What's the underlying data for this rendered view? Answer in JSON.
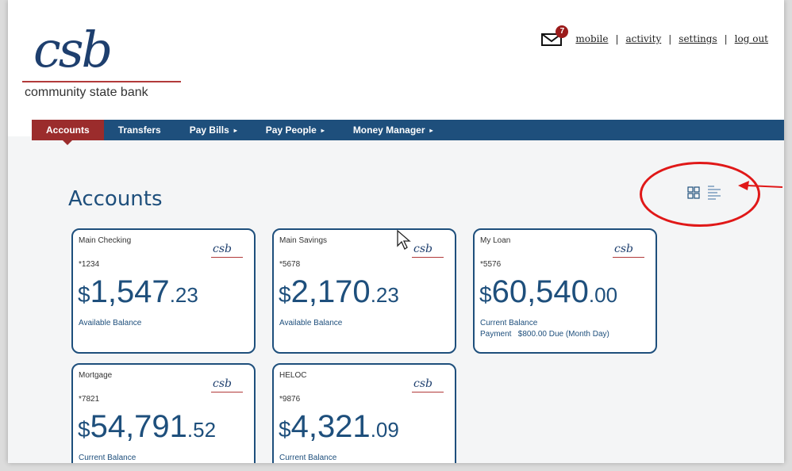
{
  "brand": {
    "logo_mark": "csb",
    "tagline": "community state bank"
  },
  "header": {
    "mail_badge": "7",
    "links": [
      "mobile",
      "activity",
      "settings",
      "log out"
    ],
    "separator": "|"
  },
  "nav": {
    "items": [
      {
        "label": "Accounts",
        "has_caret": false,
        "active": true
      },
      {
        "label": "Transfers",
        "has_caret": false,
        "active": false
      },
      {
        "label": "Pay Bills",
        "has_caret": true,
        "active": false
      },
      {
        "label": "Pay People",
        "has_caret": true,
        "active": false
      },
      {
        "label": "Money Manager",
        "has_caret": true,
        "active": false
      }
    ],
    "caret_glyph": "▸"
  },
  "main": {
    "title": "Accounts",
    "view_modes": [
      "grid-view-icon",
      "list-view-icon"
    ]
  },
  "accounts": [
    {
      "name": "Main Checking",
      "number": "*1234",
      "currency": "$",
      "whole": "1,547",
      "cents": ".23",
      "balance_label": "Available Balance",
      "payment": ""
    },
    {
      "name": "Main Savings",
      "number": "*5678",
      "currency": "$",
      "whole": "2,170",
      "cents": ".23",
      "balance_label": "Available Balance",
      "payment": ""
    },
    {
      "name": "My Loan",
      "number": "*5576",
      "currency": "$",
      "whole": "60,540",
      "cents": ".00",
      "balance_label": "Current Balance",
      "payment": "Payment   $800.00 Due (Month Day)"
    },
    {
      "name": "Mortgage",
      "number": "*7821",
      "currency": "$",
      "whole": "54,791",
      "cents": ".52",
      "balance_label": "Current Balance",
      "payment": ""
    },
    {
      "name": "HELOC",
      "number": "*9876",
      "currency": "$",
      "whole": "4,321",
      "cents": ".09",
      "balance_label": "Current Balance",
      "payment": ""
    }
  ],
  "colors": {
    "brand_blue": "#1e4f7c",
    "active_red": "#9b2c2c",
    "annotation_red": "#e01818",
    "badge_red": "#9b1b1b"
  }
}
